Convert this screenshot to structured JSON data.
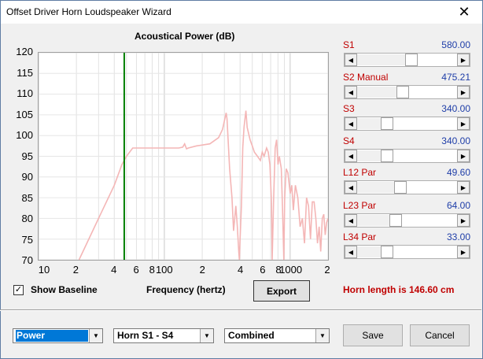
{
  "window": {
    "title": "Offset Driver Horn Loudspeaker Wizard",
    "close_glyph": "✕"
  },
  "chart_data": {
    "type": "line",
    "title": "Acoustical Power (dB)",
    "xlabel": "Frequency (hertz)",
    "ylabel": "",
    "xscale": "log",
    "xlim": [
      10,
      2000
    ],
    "ylim": [
      70,
      120
    ],
    "yticks": [
      "120",
      "115",
      "110",
      "105",
      "100",
      "95",
      "90",
      "85",
      "80",
      "75",
      "70"
    ],
    "xtick_labels": [
      "10",
      "2",
      "4",
      "6",
      "8",
      "100",
      "2",
      "4",
      "6",
      "8",
      "1000",
      "2"
    ],
    "grid": true,
    "series": [
      {
        "color": "#f4b6b6",
        "points": [
          [
            21,
            70
          ],
          [
            30,
            80
          ],
          [
            40,
            88
          ],
          [
            46,
            93
          ],
          [
            50,
            95
          ],
          [
            56,
            97
          ],
          [
            70,
            97
          ],
          [
            100,
            97
          ],
          [
            130,
            97
          ],
          [
            140,
            97.2
          ],
          [
            145,
            98
          ],
          [
            150,
            96.8
          ],
          [
            155,
            97
          ],
          [
            180,
            97.5
          ],
          [
            230,
            98
          ],
          [
            270,
            99.5
          ],
          [
            290,
            101.5
          ],
          [
            310,
            105.5
          ],
          [
            315,
            104
          ],
          [
            320,
            100
          ],
          [
            330,
            92
          ],
          [
            345,
            85
          ],
          [
            355,
            77
          ],
          [
            360,
            79
          ],
          [
            370,
            83
          ],
          [
            380,
            78
          ],
          [
            390,
            72
          ],
          [
            395,
            70
          ],
          [
            400,
            75
          ],
          [
            410,
            83
          ],
          [
            420,
            97
          ],
          [
            430,
            102
          ],
          [
            445,
            106
          ],
          [
            455,
            102
          ],
          [
            480,
            99
          ],
          [
            500,
            97.5
          ],
          [
            520,
            96
          ],
          [
            550,
            95
          ],
          [
            580,
            94
          ],
          [
            600,
            96
          ],
          [
            620,
            95
          ],
          [
            650,
            97
          ],
          [
            670,
            96
          ],
          [
            690,
            93
          ],
          [
            710,
            84
          ],
          [
            720,
            70
          ],
          [
            740,
            85
          ],
          [
            760,
            97
          ],
          [
            780,
            99
          ],
          [
            800,
            93
          ],
          [
            820,
            95
          ],
          [
            850,
            92
          ],
          [
            870,
            82
          ],
          [
            890,
            70
          ],
          [
            905,
            85
          ],
          [
            930,
            92
          ],
          [
            960,
            91
          ],
          [
            1000,
            86
          ],
          [
            1030,
            88
          ],
          [
            1060,
            82
          ],
          [
            1100,
            88
          ],
          [
            1150,
            85
          ],
          [
            1200,
            78
          ],
          [
            1250,
            80
          ],
          [
            1300,
            74
          ],
          [
            1350,
            85
          ],
          [
            1400,
            83
          ],
          [
            1450,
            75
          ],
          [
            1500,
            84
          ],
          [
            1550,
            84
          ],
          [
            1600,
            80
          ],
          [
            1650,
            74
          ],
          [
            1700,
            78
          ],
          [
            1750,
            72
          ],
          [
            1800,
            80
          ],
          [
            1850,
            81
          ],
          [
            1900,
            76
          ],
          [
            1950,
            79
          ],
          [
            2000,
            80
          ]
        ]
      },
      {
        "color": "#008000",
        "vertical_at": 48
      }
    ]
  },
  "controls": {
    "show_baseline": "Show Baseline",
    "show_baseline_checked": true,
    "export_label": "Export"
  },
  "params": [
    {
      "name": "S1",
      "value": "580.00",
      "level": 0.55
    },
    {
      "name": "S2  Manual",
      "value": "475.21",
      "level": 0.45
    },
    {
      "name": "S3",
      "value": "340.00",
      "level": 0.27
    },
    {
      "name": "S4",
      "value": "340.00",
      "level": 0.27
    },
    {
      "name": "L12  Par",
      "value": "49.60",
      "level": 0.42
    },
    {
      "name": "L23  Par",
      "value": "64.00",
      "level": 0.37
    },
    {
      "name": "L34  Par",
      "value": "33.00",
      "level": 0.27
    }
  ],
  "horn_length": "Horn length is 146.60 cm",
  "bottom": {
    "combo1": "Power",
    "combo2": "Horn S1 - S4",
    "combo3": "Combined",
    "save_label": "Save",
    "cancel_label": "Cancel"
  }
}
